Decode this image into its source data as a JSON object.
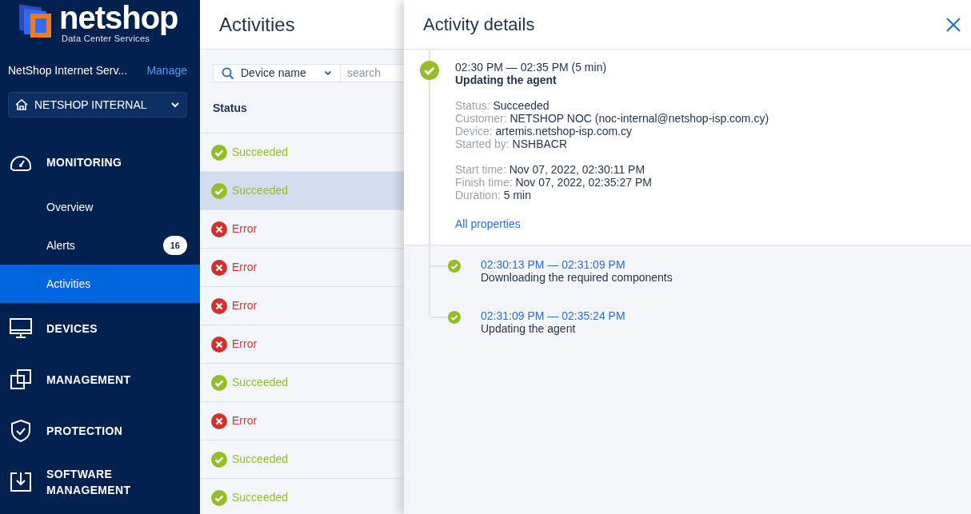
{
  "brand": {
    "name": "netshop",
    "tagline": "Data Center Services"
  },
  "sidebar": {
    "account": "NetShop Internet Serv...",
    "manage": "Manage",
    "tenant": "NETSHOP INTERNAL",
    "nav": [
      {
        "label": "MONITORING",
        "children": [
          {
            "label": "Overview",
            "selected": false
          },
          {
            "label": "Alerts",
            "badge": "16",
            "selected": false
          },
          {
            "label": "Activities",
            "selected": true
          }
        ]
      },
      {
        "label": "DEVICES"
      },
      {
        "label": "MANAGEMENT"
      },
      {
        "label": "PROTECTION"
      },
      {
        "label": "SOFTWARE MANAGEMENT"
      }
    ]
  },
  "activities": {
    "title": "Activities",
    "filter": "Device name",
    "search_placeholder": "search",
    "column": "Status",
    "rows": [
      {
        "kind": "succeeded",
        "status": "Succeeded",
        "selected": false
      },
      {
        "kind": "succeeded",
        "status": "Succeeded",
        "selected": true
      },
      {
        "kind": "error",
        "status": "Error",
        "selected": false
      },
      {
        "kind": "error",
        "status": "Error",
        "selected": false
      },
      {
        "kind": "error",
        "status": "Error",
        "selected": false
      },
      {
        "kind": "error",
        "status": "Error",
        "selected": false
      },
      {
        "kind": "succeeded",
        "status": "Succeeded",
        "selected": false
      },
      {
        "kind": "error",
        "status": "Error",
        "selected": false
      },
      {
        "kind": "succeeded",
        "status": "Succeeded",
        "selected": false
      },
      {
        "kind": "succeeded",
        "status": "Succeeded",
        "selected": false
      }
    ]
  },
  "details": {
    "title": "Activity details",
    "time": "02:30 PM — 02:35 PM (5 min)",
    "name": "Updating the agent",
    "groups": [
      [
        {
          "label": "Status:",
          "value": "Succeeded"
        },
        {
          "label": "Customer:",
          "value": "NETSHOP NOC (noc-internal@netshop-isp.com.cy)"
        },
        {
          "label": "Device:",
          "value": "artemis.netshop-isp.com.cy"
        },
        {
          "label": "Started by:",
          "value": "NSHBACR"
        }
      ],
      [
        {
          "label": "Start time:",
          "value": "Nov 07, 2022, 02:30:11 PM"
        },
        {
          "label": "Finish time:",
          "value": "Nov 07, 2022, 02:35:27 PM"
        },
        {
          "label": "Duration:",
          "value": "5 min"
        }
      ]
    ],
    "link": "All properties",
    "steps": [
      {
        "time": "02:30:13 PM — 02:31:09 PM",
        "name": "Downloading the required components"
      },
      {
        "time": "02:31:09 PM — 02:35:24 PM",
        "name": "Updating the agent"
      }
    ]
  }
}
